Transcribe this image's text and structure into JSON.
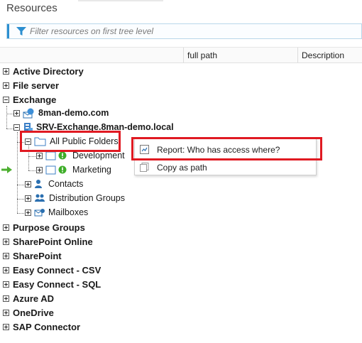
{
  "panel": {
    "title": "Resources"
  },
  "filter": {
    "placeholder": "Filter resources on first tree level",
    "icon": "filter-icon"
  },
  "columns": {
    "full_path": "full path",
    "description": "Description"
  },
  "tree": {
    "active_directory": "Active Directory",
    "file_server": "File server",
    "exchange": "Exchange",
    "demo_com": "8man-demo.com",
    "srv_exchange": "SRV-Exchange.8man-demo.local",
    "all_public_folders": "All Public Folders",
    "development": "Development",
    "marketing": "Marketing",
    "contacts": "Contacts",
    "distribution_groups": "Distribution Groups",
    "mailboxes": "Mailboxes",
    "purpose_groups": "Purpose Groups",
    "sharepoint_online": "SharePoint Online",
    "sharepoint": "SharePoint",
    "easy_connect_csv": "Easy Connect - CSV",
    "easy_connect_sql": "Easy Connect - SQL",
    "azure_ad": "Azure AD",
    "onedrive": "OneDrive",
    "sap_connector": "SAP Connector"
  },
  "context_menu": {
    "report": "Report: Who has access where?",
    "copy_path": "Copy as path"
  },
  "colors": {
    "accent": "#2c8fd0",
    "highlight": "#e01a22",
    "warning": "#3fae2a",
    "arrow": "#4caf2f"
  }
}
